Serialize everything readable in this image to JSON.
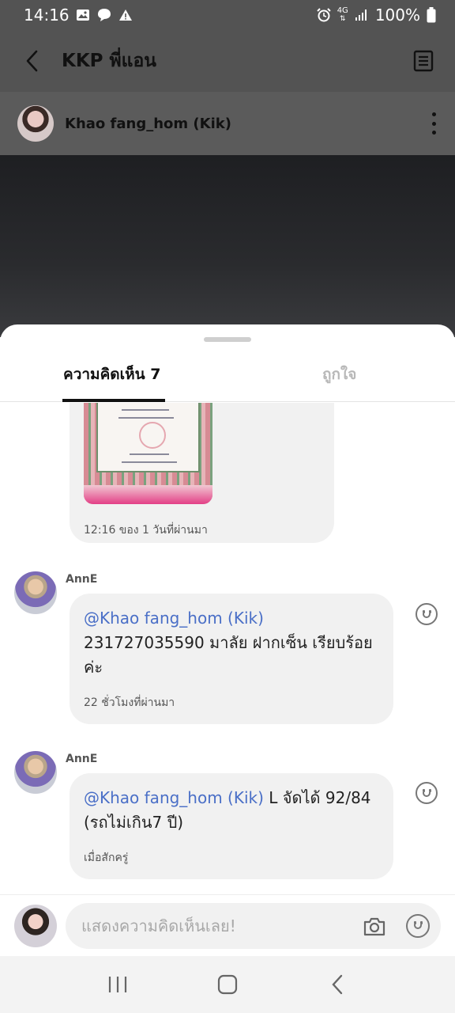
{
  "status_bar": {
    "time": "14:16",
    "network": "4G",
    "battery": "100%",
    "icons_left": [
      "gallery-icon",
      "chat-bubble-icon",
      "warning-icon"
    ],
    "icons_right": [
      "alarm-icon",
      "network-icon",
      "signal-icon",
      "battery-icon"
    ]
  },
  "header": {
    "title": "KKP พี่แอน",
    "back_icon": "chevron-left-icon",
    "doc_icon": "document-icon"
  },
  "post_author": {
    "name": "Khao fang_hom (Kik)"
  },
  "tabs": [
    {
      "label": "ความคิดเห็น 7",
      "active": true
    },
    {
      "label": "ถูกใจ",
      "active": false
    }
  ],
  "comments": {
    "first_partial": {
      "time": "12:16 ของ 1 วันที่ผ่านมา"
    },
    "items": [
      {
        "author": "AnnE",
        "mention": "@Khao fang_hom (Kik)",
        "text": "231727035590 มาลัย ฝากเซ็น เรียบร้อยค่ะ",
        "time": "22 ชั่วโมงที่ผ่านมา"
      },
      {
        "author": "AnnE",
        "mention": "@Khao fang_hom (Kik)",
        "text": " L จัดได้ 92/84 (รถไม่เกิน7 ปี)",
        "time": "เมื่อสักครู่"
      }
    ]
  },
  "input": {
    "placeholder": "แสดงความคิดเห็นเลย!"
  },
  "colors": {
    "mention": "#4a6fc7",
    "bubble": "#f1f1f1",
    "dim_overlay": "#535353"
  }
}
